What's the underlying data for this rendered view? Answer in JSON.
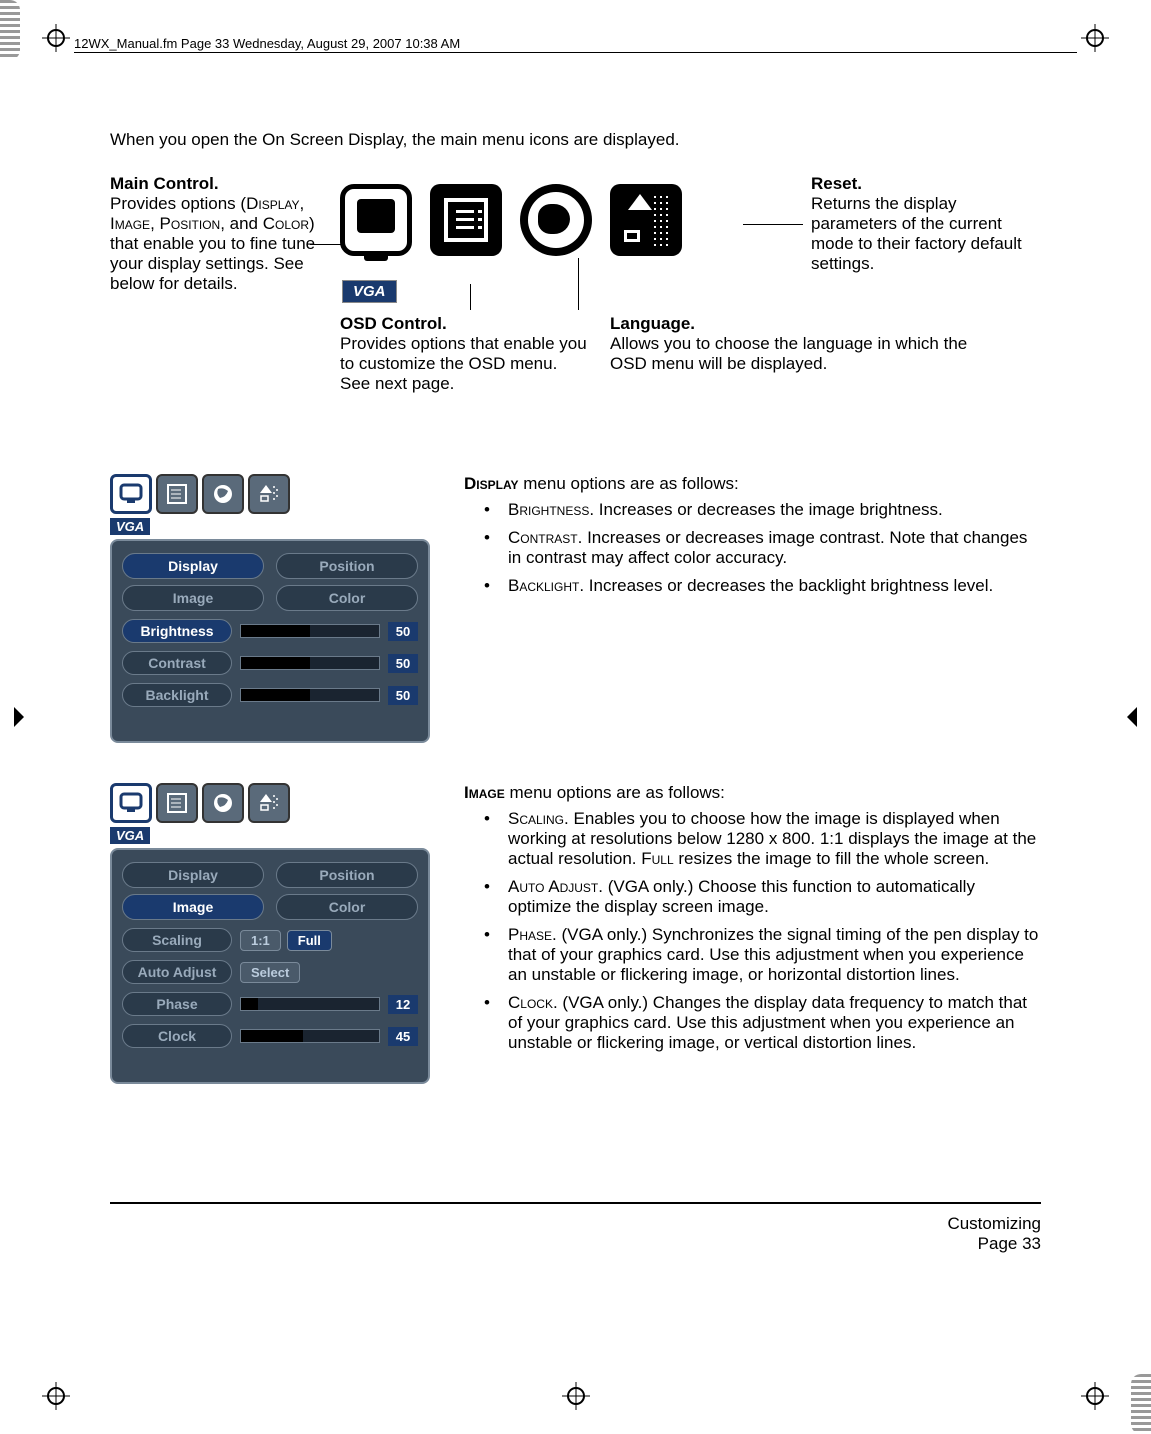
{
  "header": "12WX_Manual.fm  Page 33  Wednesday, August 29, 2007  10:38 AM",
  "intro": "When you open the On Screen Display, the main menu icons are displayed.",
  "main_control": {
    "title": "Main Control.",
    "body_pre": "Provides options (",
    "opt1": "Display",
    "opt2": "Image",
    "opt3": "Position",
    "opt4": "Color",
    "body_post": ") that enable you to fine tune your display settings.  See below for details."
  },
  "vga_label": "VGA",
  "osd_control": {
    "title": "OSD Control.",
    "body": "Provides options that enable you to customize the OSD menu.  See next page."
  },
  "language": {
    "title": "Language.",
    "body": "Allows you to choose the language in which the OSD menu will be displayed."
  },
  "reset": {
    "title": "Reset.",
    "body": "Returns the display parameters of the current mode to their factory default settings."
  },
  "display_menu": {
    "heading_sc": "Display",
    "heading_rest": " menu options are as follows:",
    "items": [
      {
        "sc": "Brightness",
        "rest": ".  Increases or decreases the image brightness."
      },
      {
        "sc": "Contrast",
        "rest": ".  Increases or decreases image contrast.  Note that changes in contrast may affect color accuracy."
      },
      {
        "sc": "Backlight",
        "rest": ".  Increases or decreases the backlight brightness level."
      }
    ],
    "panel": {
      "tabs_top": [
        "Display",
        "Position"
      ],
      "tabs_bot": [
        "Image",
        "Color"
      ],
      "selected_top": 0,
      "params": [
        {
          "label": "Brightness",
          "value": 50,
          "selected": true
        },
        {
          "label": "Contrast",
          "value": 50
        },
        {
          "label": "Backlight",
          "value": 50
        }
      ]
    }
  },
  "image_menu": {
    "heading_sc": "Image",
    "heading_rest": " menu options are as follows:",
    "items": [
      {
        "sc": "Scaling",
        "rest": ".  Enables you to choose how the image is displayed when working at resolutions below 1280 x 800.  1:1 displays the image at the actual resolution.  ",
        "sc2": "Full",
        "rest2": " resizes the image to fill the whole screen."
      },
      {
        "sc": "Auto Adjust",
        "rest": ".  (VGA only.)  Choose this function to automatically optimize the display screen image."
      },
      {
        "sc": "Phase",
        "rest": ".  (VGA only.)  Synchronizes the signal timing of the pen display to that of your graphics card.  Use this adjustment when you experience an unstable or flickering image, or horizontal distortion lines."
      },
      {
        "sc": "Clock",
        "rest": ".  (VGA only.)  Changes the display data frequency to match that of your graphics card.  Use this adjustment when you experience an unstable or flickering image, or vertical distortion lines."
      }
    ],
    "panel": {
      "tabs_top": [
        "Display",
        "Position"
      ],
      "tabs_bot": [
        "Image",
        "Color"
      ],
      "selected_bot": 0,
      "scaling": {
        "label": "Scaling",
        "opts": [
          "1:1",
          "Full"
        ],
        "sel": 1
      },
      "auto": {
        "label": "Auto Adjust",
        "btn": "Select"
      },
      "phase": {
        "label": "Phase",
        "value": 12
      },
      "clock": {
        "label": "Clock",
        "value": 45
      }
    }
  },
  "footer": {
    "line1": "Customizing",
    "line2": "Page  33"
  }
}
